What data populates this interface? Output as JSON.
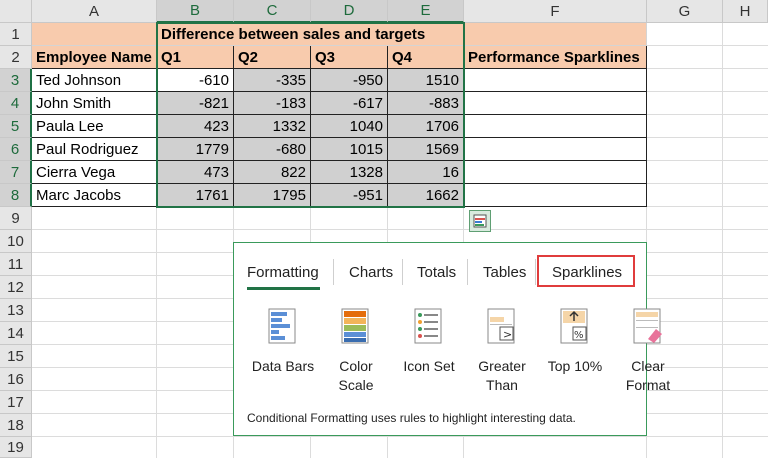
{
  "columns": [
    "A",
    "B",
    "C",
    "D",
    "E",
    "F",
    "G",
    "H"
  ],
  "rows": [
    "1",
    "2",
    "3",
    "4",
    "5",
    "6",
    "7",
    "8",
    "9",
    "10",
    "11",
    "12",
    "13",
    "14",
    "15",
    "16",
    "17",
    "18",
    "19"
  ],
  "sheet": {
    "title": "Difference between sales and targets",
    "headers": [
      "Employee Name",
      "Q1",
      "Q2",
      "Q3",
      "Q4"
    ],
    "f_header": "Performance Sparklines",
    "data": [
      {
        "name": "Ted Johnson",
        "q1": "-610",
        "q2": "-335",
        "q3": "-950",
        "q4": "1510"
      },
      {
        "name": "John Smith",
        "q1": "-821",
        "q2": "-183",
        "q3": "-617",
        "q4": "-883"
      },
      {
        "name": "Paula Lee",
        "q1": "423",
        "q2": "1332",
        "q3": "1040",
        "q4": "1706"
      },
      {
        "name": "Paul Rodriguez",
        "q1": "1779",
        "q2": "-680",
        "q3": "1015",
        "q4": "1569"
      },
      {
        "name": "Cierra Vega",
        "q1": "473",
        "q2": "822",
        "q3": "1328",
        "q4": "16"
      },
      {
        "name": "Marc Jacobs",
        "q1": "1761",
        "q2": "1795",
        "q3": "-951",
        "q4": "1662"
      }
    ]
  },
  "quick_analysis": {
    "tabs": [
      {
        "label": "Formatting",
        "active": true
      },
      {
        "label": "Charts"
      },
      {
        "label": "Totals"
      },
      {
        "label": "Tables"
      },
      {
        "label": "Sparklines",
        "highlighted": true
      }
    ],
    "buttons": [
      {
        "label": "Data Bars",
        "icon": "data-bars-icon"
      },
      {
        "label": "Color\nScale",
        "icon": "color-scale-icon"
      },
      {
        "label": "Icon Set",
        "icon": "icon-set-icon"
      },
      {
        "label": "Greater\nThan",
        "icon": "greater-than-icon"
      },
      {
        "label": "Top 10%",
        "icon": "top-10-percent-icon"
      },
      {
        "label": "Clear\nFormat",
        "icon": "clear-format-icon"
      }
    ],
    "description": "Conditional Formatting uses rules to highlight interesting data."
  },
  "colors": {
    "accent": "#217346",
    "header_fill": "#f8cbad",
    "highlight_box": "#e03c3c"
  }
}
